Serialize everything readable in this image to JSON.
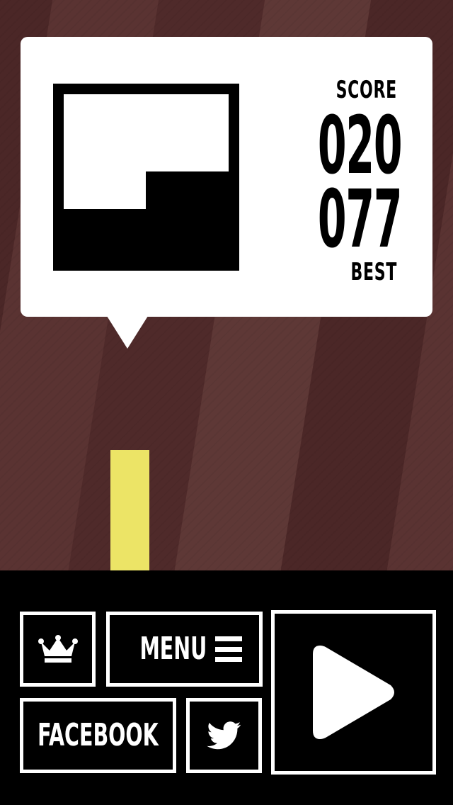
{
  "colors": {
    "background": "#56302f",
    "stripe_dark": "#4b2727",
    "stripe_light": "#5e3836",
    "player_block": "#ece466",
    "bubble": "#ffffff",
    "panel": "#000000",
    "button_border": "#ffffff"
  },
  "score_card": {
    "score_label": "SCORE",
    "score_value": "020",
    "best_value": "077",
    "best_label": "BEST",
    "preview_icon": "shape-preview-icon"
  },
  "buttons": {
    "leaderboard_icon": "crown-icon",
    "menu_label": "MENU",
    "menu_icon": "hamburger-icon",
    "facebook_label": "FACEBOOK",
    "twitter_icon": "twitter-bird-icon",
    "play_icon": "play-icon"
  }
}
